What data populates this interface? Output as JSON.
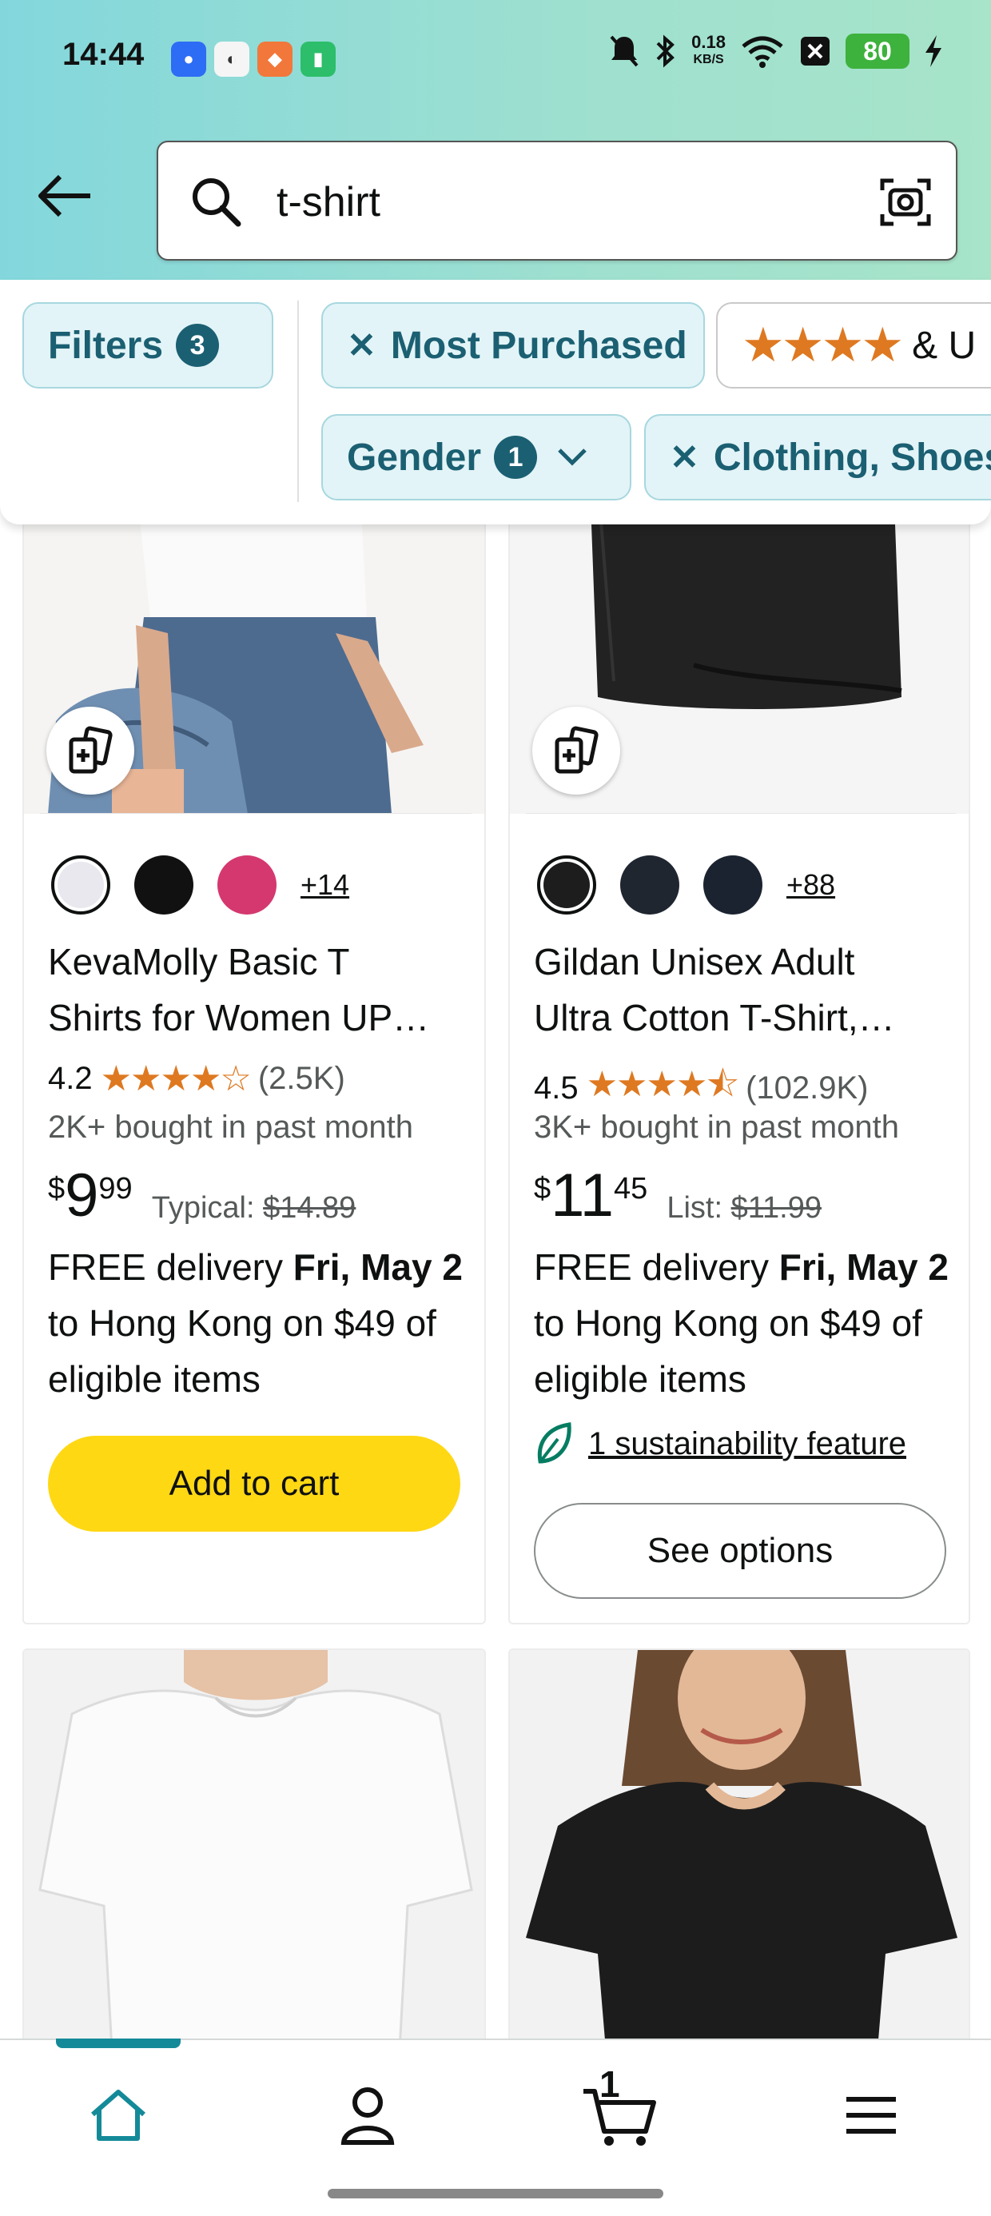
{
  "status_bar": {
    "time": "14:44",
    "net_speed_value": "0.18",
    "net_speed_unit": "KB/S",
    "battery": "80"
  },
  "search": {
    "query": "t-shirt"
  },
  "filters": {
    "filters_label": "Filters",
    "filters_count": "3",
    "most_purchased": "Most Purchased",
    "rating_suffix": "& U",
    "gender_label": "Gender",
    "gender_count": "1",
    "clothing_label": "Clothing, Shoes"
  },
  "products": [
    {
      "swatch_colors": [
        "#e8e8ee",
        "#111111",
        "#d4386f"
      ],
      "swatch_more": "+14",
      "title_line1": "KevaMolly Basic T",
      "title_line2": "Shirts for Women UP…",
      "rating": "4.2",
      "stars": "★★★★☆",
      "review_count": "(2.5K)",
      "bought": "2K+ bought in past month",
      "price_currency": "$",
      "price_whole": "9",
      "price_fraction": "99",
      "price_ref_label": "Typical:",
      "price_ref_value": "$14.89",
      "delivery_pre": "FREE delivery ",
      "delivery_date": "Fri, May 2",
      "delivery_post": " to Hong Kong on $49 of eligible items",
      "cta": "Add to cart"
    },
    {
      "swatch_colors": [
        "#1d1d1d",
        "#1f2630",
        "#1b2330"
      ],
      "swatch_more": "+88",
      "title_line1": "Gildan Unisex Adult",
      "title_line2": "Ultra Cotton T-Shirt,…",
      "rating": "4.5",
      "stars": "★★★★⯪",
      "review_count": "(102.9K)",
      "bought": "3K+ bought in past month",
      "price_currency": "$",
      "price_whole": "11",
      "price_fraction": "45",
      "price_ref_label": "List:",
      "price_ref_value": "$11.99",
      "delivery_pre": "FREE delivery ",
      "delivery_date": "Fri, May 2",
      "delivery_post": " to Hong Kong on $49 of eligible items",
      "sustainability": "1 sustainability feature",
      "cta": "See options"
    }
  ],
  "bottom_nav": {
    "cart_count": "1",
    "items": [
      "home",
      "account",
      "cart",
      "menu"
    ]
  },
  "colors": {
    "header_gradient_start": "#83d7dc",
    "chip_bg": "#e2f4f7",
    "chip_text": "#1b5f72",
    "star": "#de7921",
    "add_to_cart": "#ffd814",
    "nav_active": "#148a99"
  }
}
